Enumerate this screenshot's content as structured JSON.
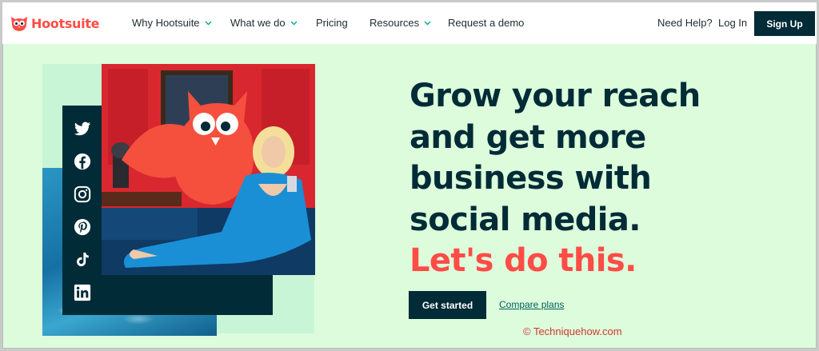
{
  "brand": {
    "name": "Hootsuite",
    "color": "#ff4c46",
    "dark": "#012b36",
    "background": "#dcfcdc"
  },
  "nav": {
    "items": [
      {
        "label": "Why Hootsuite",
        "has_dropdown": true
      },
      {
        "label": "What we do",
        "has_dropdown": true
      },
      {
        "label": "Pricing",
        "has_dropdown": false
      },
      {
        "label": "Resources",
        "has_dropdown": true
      },
      {
        "label": "Request a demo",
        "has_dropdown": false
      }
    ],
    "help_label": "Need Help?",
    "login_label": "Log In",
    "signup_label": "Sign Up"
  },
  "hero": {
    "headline_lines": [
      "Grow your reach",
      "and get more",
      "business with",
      "social media."
    ],
    "accent_line": "Let's do this.",
    "cta_primary": "Get started",
    "cta_secondary": "Compare plans",
    "social_icons": [
      "twitter-icon",
      "facebook-icon",
      "instagram-icon",
      "pinterest-icon",
      "tiktok-icon",
      "linkedin-icon"
    ]
  },
  "watermark": "© Techniquehow.com"
}
